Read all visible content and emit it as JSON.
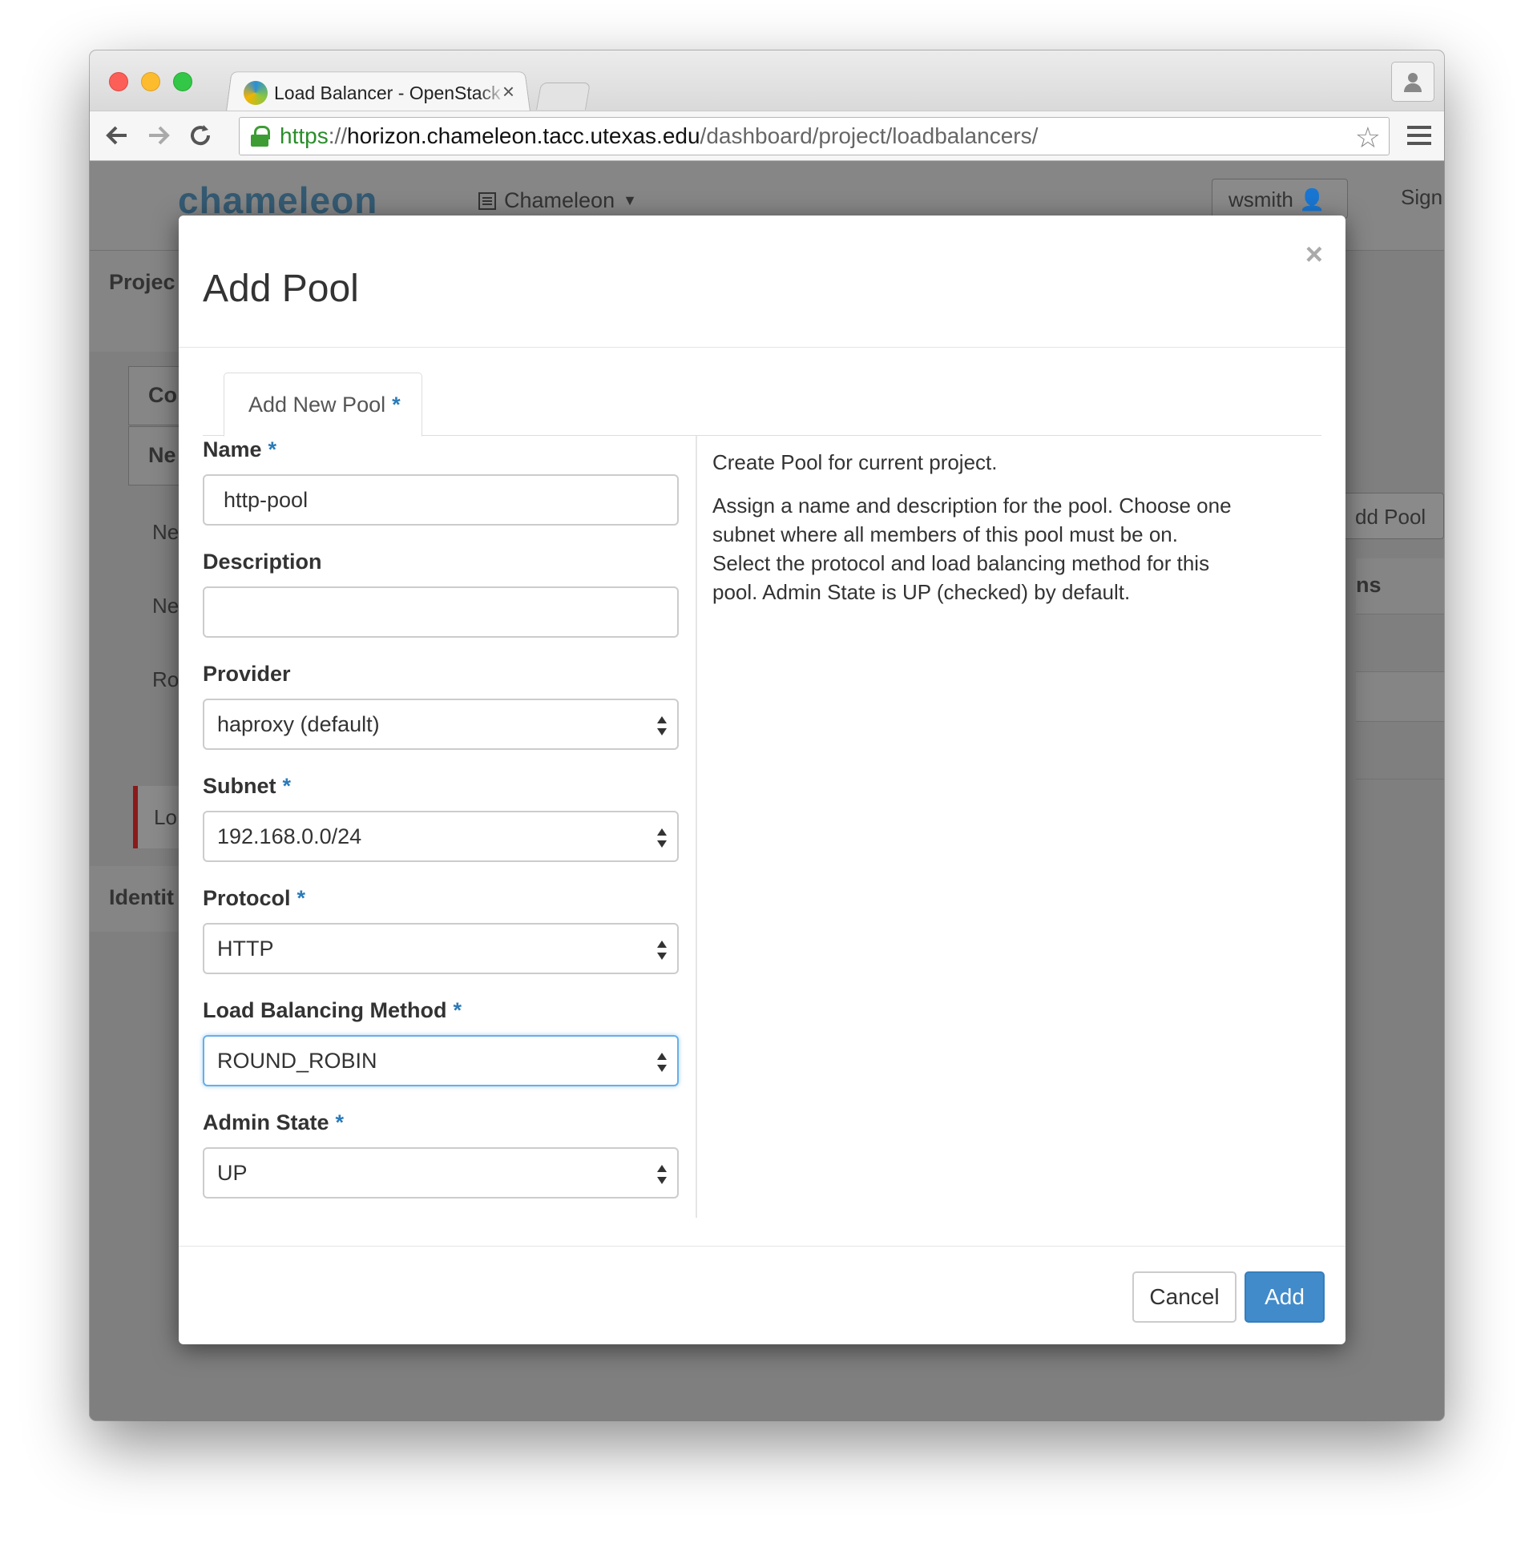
{
  "browser": {
    "tab_title": "Load Balancer - OpenStack",
    "tab_close": "×",
    "url_scheme": "https",
    "url_sep": "://",
    "url_host": "horizon.chameleon.tacc.utexas.edu",
    "url_path": "/dashboard/project/loadbalancers/"
  },
  "background_page": {
    "logo": "chameleon",
    "project_selector": "Chameleon",
    "user_menu": "wsmith",
    "sign_out": "Sign",
    "sidebar": {
      "project_heading": "Projec",
      "compute": "Co",
      "network": "Ne",
      "items": [
        "Ne",
        "Ne",
        "Ro",
        "Lo"
      ],
      "identity_heading": "Identit"
    },
    "add_pool_button": "dd Pool",
    "table_header_actions": "ns"
  },
  "modal": {
    "title": "Add Pool",
    "close": "×",
    "tab_label": "Add New Pool",
    "required_marker": "*",
    "fields": {
      "name": {
        "label": "Name",
        "value": "http-pool"
      },
      "description": {
        "label": "Description",
        "value": ""
      },
      "provider": {
        "label": "Provider",
        "value": "haproxy (default)"
      },
      "subnet": {
        "label": "Subnet",
        "value": "192.168.0.0/24"
      },
      "protocol": {
        "label": "Protocol",
        "value": "HTTP"
      },
      "lb_method": {
        "label": "Load Balancing Method",
        "value": "ROUND_ROBIN"
      },
      "admin_state": {
        "label": "Admin State",
        "value": "UP"
      }
    },
    "help": {
      "line1": "Create Pool for current project.",
      "line2": "Assign a name and description for the pool. Choose one subnet where all members of this pool must be on. Select the protocol and load balancing method for this pool. Admin State is UP (checked) by default."
    },
    "buttons": {
      "cancel": "Cancel",
      "add": "Add"
    }
  }
}
